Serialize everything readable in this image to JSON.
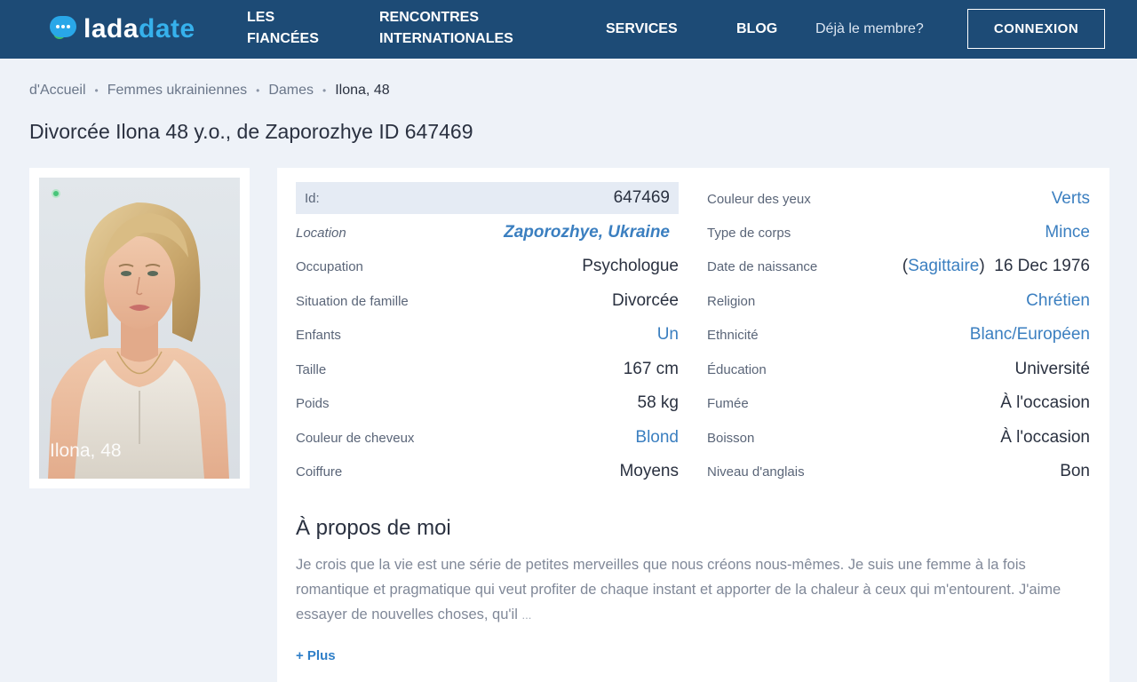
{
  "header": {
    "logo": {
      "part1": "lada",
      "part2": "date"
    },
    "nav": {
      "les_line1": "LES",
      "les_line2": "FIANCÉES",
      "rencontres_line1": "RENCONTRES",
      "rencontres_line2": "INTERNATIONALES",
      "services": "SERVICES",
      "blog": "BLOG"
    },
    "member_text": "Déjà le membre?",
    "login_button": "CONNEXION"
  },
  "breadcrumb": {
    "home": "d'Accueil",
    "women": "Femmes ukrainiennes",
    "ladies": "Dames",
    "current": "Ilona, 48"
  },
  "page_title": "Divorcée Ilona 48 y.o., de Zaporozhye ID 647469",
  "photo": {
    "caption": "Ilona, 48",
    "online": true
  },
  "details_left": [
    {
      "label": "Id:",
      "value": "647469"
    },
    {
      "label": "Location",
      "value": "Zaporozhye, Ukraine"
    },
    {
      "label": "Occupation",
      "value": "Psychologue"
    },
    {
      "label": "Situation de famille",
      "value": "Divorcée"
    },
    {
      "label": "Enfants",
      "value": "Un"
    },
    {
      "label": "Taille",
      "value": "167 cm"
    },
    {
      "label": "Poids",
      "value": "58 kg"
    },
    {
      "label": "Couleur de cheveux",
      "value": "Blond"
    },
    {
      "label": "Coiffure",
      "value": "Moyens"
    }
  ],
  "details_right": [
    {
      "label": "Couleur des yeux",
      "value": "Verts"
    },
    {
      "label": "Type de corps",
      "value": "Mince"
    },
    {
      "label": "Date de naissance",
      "zodiac_open": "(",
      "zodiac": "Sagittaire",
      "zodiac_close": ")",
      "value": "16 Dec 1976"
    },
    {
      "label": "Religion",
      "value": "Chrétien"
    },
    {
      "label": "Ethnicité",
      "value": "Blanc/Européen"
    },
    {
      "label": "Éducation",
      "value": "Université"
    },
    {
      "label": "Fumée",
      "value": "À l'occasion"
    },
    {
      "label": "Boisson",
      "value": "À l'occasion"
    },
    {
      "label": "Niveau d'anglais",
      "value": "Bon"
    }
  ],
  "about": {
    "title": "À propos de moi",
    "text": "Je crois que la vie est une série de petites merveilles que nous créons nous-mêmes. Je suis une femme à la fois romantique et pragmatique qui veut profiter de chaque instant et apporter de la chaleur à ceux qui m'entourent. J'aime essayer de nouvelles choses, qu'il",
    "ellipsis": "...",
    "more_label": "+ Plus"
  },
  "colors": {
    "header_bg": "#1d4b76",
    "link": "#3b7fc0",
    "page_bg": "#eef2f8",
    "logo_accent": "#36b1ec",
    "online": "#48c57a"
  }
}
